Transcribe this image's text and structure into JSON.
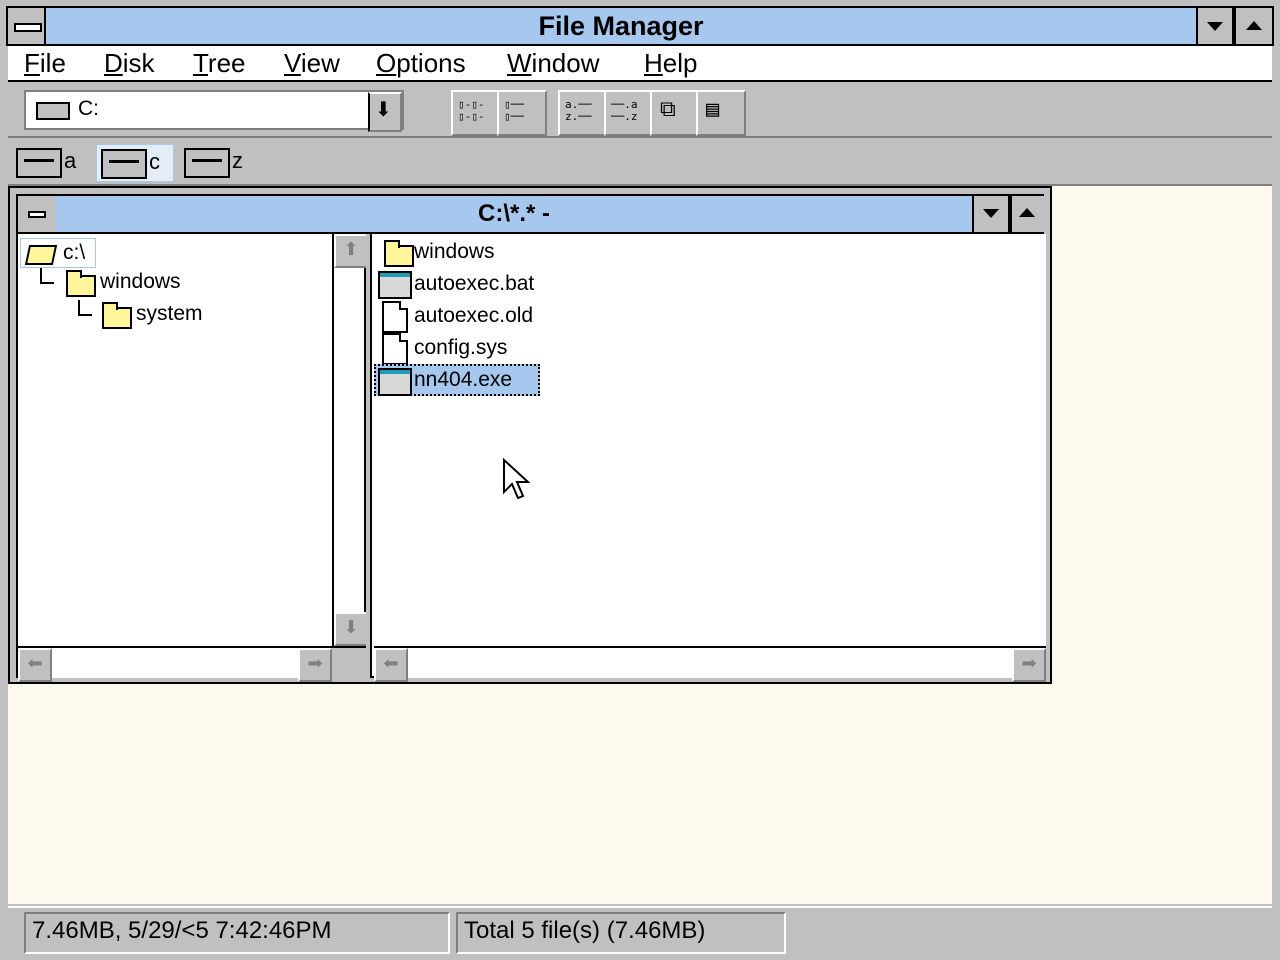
{
  "window": {
    "title": "File Manager"
  },
  "menu": [
    "File",
    "Disk",
    "Tree",
    "View",
    "Options",
    "Window",
    "Help"
  ],
  "toolbar": {
    "drive_value": "C:",
    "buttons": [
      "large-icons-view",
      "list-view",
      "sort-by-name",
      "sort-by-type",
      "copy",
      "connect-network-drive"
    ]
  },
  "drives": [
    {
      "letter": "a",
      "icon": "floppy-drive-icon"
    },
    {
      "letter": "c",
      "icon": "hard-drive-icon"
    },
    {
      "letter": "z",
      "icon": "network-drive-icon"
    }
  ],
  "child": {
    "title": "C:\\*.* -",
    "tree": [
      {
        "label": "c:\\",
        "icon": "open-folder-icon"
      },
      {
        "label": "windows",
        "icon": "folder-icon"
      },
      {
        "label": "system",
        "icon": "folder-icon"
      }
    ],
    "files": [
      {
        "name": "windows",
        "icon": "folder-icon"
      },
      {
        "name": "autoexec.bat",
        "icon": "program-icon"
      },
      {
        "name": "autoexec.old",
        "icon": "document-icon"
      },
      {
        "name": "config.sys",
        "icon": "document-icon"
      },
      {
        "name": "nn404.exe",
        "icon": "program-icon",
        "selected": true
      }
    ]
  },
  "status": {
    "left": "7.46MB, 5/29/<5 7:42:46PM",
    "right": "Total 5 file(s) (7.46MB)"
  },
  "colors": {
    "titlebar": "#a6c8ee",
    "workspace": "#fdf9ef",
    "selection": "#a6c8ee"
  }
}
